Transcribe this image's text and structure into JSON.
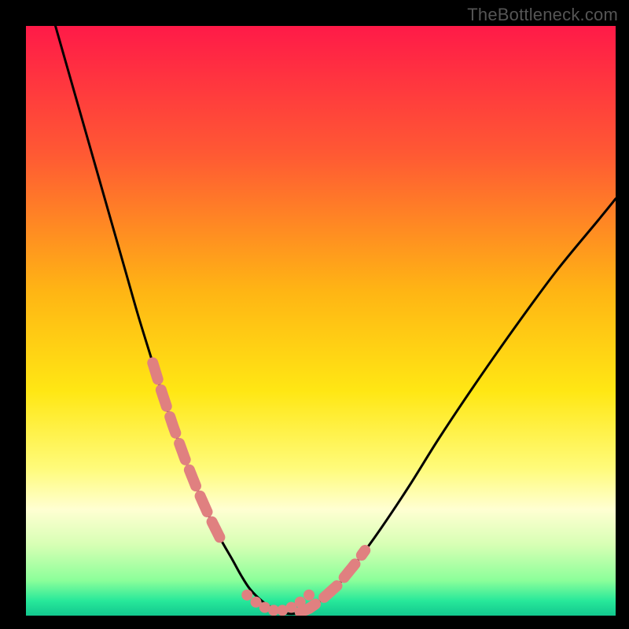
{
  "watermark": "TheBottleneck.com",
  "chart_data": {
    "type": "line",
    "title": "",
    "xlabel": "",
    "ylabel": "",
    "xlim": [
      0,
      100
    ],
    "ylim": [
      0,
      100
    ],
    "grid": false,
    "legend": false,
    "background_gradient_stops": [
      {
        "offset": 0.0,
        "color": "#ff1a48"
      },
      {
        "offset": 0.22,
        "color": "#ff5a33"
      },
      {
        "offset": 0.45,
        "color": "#ffb514"
      },
      {
        "offset": 0.62,
        "color": "#ffe714"
      },
      {
        "offset": 0.75,
        "color": "#fffb7a"
      },
      {
        "offset": 0.82,
        "color": "#ffffd2"
      },
      {
        "offset": 0.88,
        "color": "#d7ffb4"
      },
      {
        "offset": 0.94,
        "color": "#8cff9a"
      },
      {
        "offset": 0.975,
        "color": "#27e89a"
      },
      {
        "offset": 1.0,
        "color": "#12c78e"
      }
    ],
    "curve": {
      "x": [
        5,
        7,
        9,
        11,
        13,
        15,
        17,
        19,
        21,
        23,
        25,
        27,
        29,
        31,
        33,
        35,
        36.5,
        38,
        40,
        42,
        44,
        46,
        48,
        50,
        53,
        56,
        60,
        65,
        70,
        76,
        83,
        90,
        97,
        100
      ],
      "y": [
        100,
        93,
        86,
        79,
        72,
        65,
        58,
        51,
        44.5,
        38,
        32,
        26.5,
        21.5,
        17,
        13,
        9.5,
        6.8,
        4.5,
        2.5,
        1.2,
        0.4,
        0.4,
        1.2,
        2.6,
        5.3,
        9.0,
        14.5,
        22,
        30,
        39,
        49,
        58.5,
        67,
        70.7
      ]
    },
    "highlight_segments": {
      "left": {
        "x_start": 21.5,
        "x_end": 33.0
      },
      "right": {
        "x_start": 46.5,
        "x_end": 57.5
      }
    },
    "highlight_dots_bottom": {
      "x": [
        37.5,
        39,
        40.5,
        42,
        43.5,
        45,
        46.5,
        48
      ],
      "y": [
        3.5,
        2.3,
        1.4,
        0.9,
        0.9,
        1.4,
        2.3,
        3.5
      ]
    }
  }
}
